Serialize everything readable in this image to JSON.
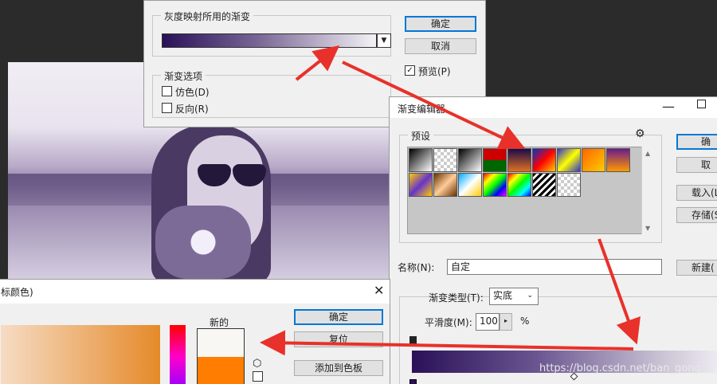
{
  "gradient_map": {
    "section_title": "灰度映射所用的渐变",
    "ok": "确定",
    "cancel": "取消",
    "preview": "预览(P)",
    "options_title": "渐变选项",
    "dither": "仿色(D)",
    "reverse": "反向(R)"
  },
  "gradient_editor": {
    "title": "渐变编辑器",
    "presets": "预设",
    "ok": "确",
    "cancel": "取",
    "load": "载入(L",
    "save": "存储(S",
    "name_label": "名称(N):",
    "name_value": "自定",
    "new": "新建(",
    "gradient_type_label": "渐变类型(T):",
    "gradient_type_value": "实底",
    "smoothness_label": "平滑度(M):",
    "smoothness_value": "100",
    "smoothness_unit": "%"
  },
  "color_picker": {
    "title": "标颜色)",
    "new_label": "新的",
    "ok": "确定",
    "reset": "复位",
    "add_swatch": "添加到色板"
  },
  "watermark": "https://blog.csdn.net/ban_gong"
}
